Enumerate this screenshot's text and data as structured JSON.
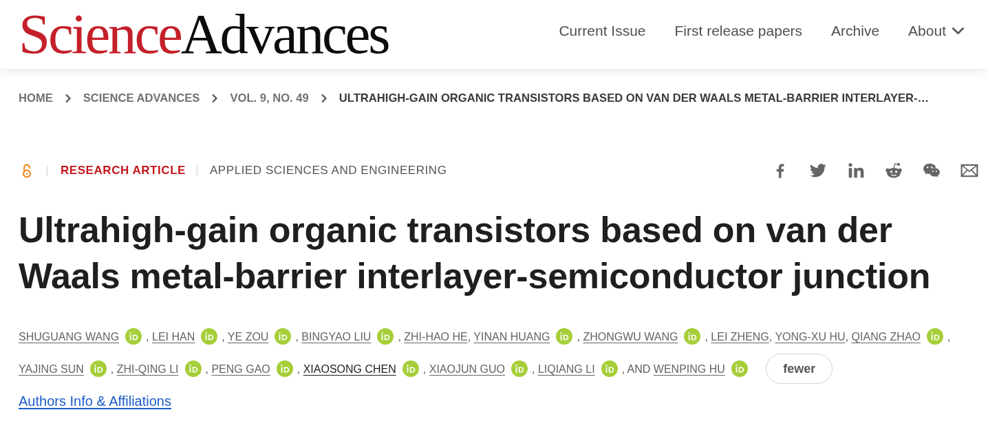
{
  "header": {
    "logo": {
      "first": "Science",
      "second": "Advances"
    },
    "nav": [
      {
        "label": "Current Issue",
        "kind": "link"
      },
      {
        "label": "First release papers",
        "kind": "link"
      },
      {
        "label": "Archive",
        "kind": "link"
      },
      {
        "label": "About",
        "kind": "dropdown"
      }
    ]
  },
  "breadcrumb": [
    {
      "label": "HOME",
      "current": false
    },
    {
      "label": "SCIENCE ADVANCES",
      "current": false
    },
    {
      "label": "VOL. 9, NO. 49",
      "current": false
    },
    {
      "label": "ULTRAHIGH-GAIN ORGANIC TRANSISTORS BASED ON VAN DER WAALS METAL-BARRIER INTERLAYER-…",
      "current": true
    }
  ],
  "article": {
    "type": "RESEARCH ARTICLE",
    "subject": "APPLIED SCIENCES AND ENGINEERING",
    "title": "Ultrahigh-gain organic transistors based on van der Waals metal-barrier interlayer-semiconductor junction",
    "authors": [
      {
        "name": "SHUGUANG WANG",
        "orcid": true,
        "highlighted": false,
        "separator": ","
      },
      {
        "name": "LEI HAN",
        "orcid": true,
        "highlighted": false,
        "separator": ","
      },
      {
        "name": "YE ZOU",
        "orcid": true,
        "highlighted": false,
        "separator": ","
      },
      {
        "name": "BINGYAO LIU",
        "orcid": true,
        "highlighted": false,
        "separator": ","
      },
      {
        "name": "ZHI-HAO HE",
        "orcid": false,
        "highlighted": false,
        "separator": ","
      },
      {
        "name": "YINAN HUANG",
        "orcid": true,
        "highlighted": false,
        "separator": ","
      },
      {
        "name": "ZHONGWU WANG",
        "orcid": true,
        "highlighted": false,
        "separator": ","
      },
      {
        "name": "LEI ZHENG",
        "orcid": false,
        "highlighted": false,
        "separator": ","
      },
      {
        "name": "YONG-XU HU",
        "orcid": false,
        "highlighted": false,
        "separator": ","
      },
      {
        "name": "QIANG ZHAO",
        "orcid": true,
        "highlighted": false,
        "separator": ","
      },
      {
        "name": "YAJING SUN",
        "orcid": true,
        "highlighted": false,
        "separator": ","
      },
      {
        "name": "ZHI-QING LI",
        "orcid": true,
        "highlighted": false,
        "separator": ","
      },
      {
        "name": "PENG GAO",
        "orcid": true,
        "highlighted": false,
        "separator": ","
      },
      {
        "name": "XIAOSONG CHEN",
        "orcid": true,
        "highlighted": true,
        "separator": ","
      },
      {
        "name": "XIAOJUN GUO",
        "orcid": true,
        "highlighted": false,
        "separator": ","
      },
      {
        "name": "LIQIANG LI",
        "orcid": true,
        "highlighted": false,
        "separator": ", AND"
      },
      {
        "name": "WENPING HU",
        "orcid": true,
        "highlighted": false
      }
    ],
    "fewer_button": "fewer",
    "info_link": "Authors Info & Affiliations"
  }
}
